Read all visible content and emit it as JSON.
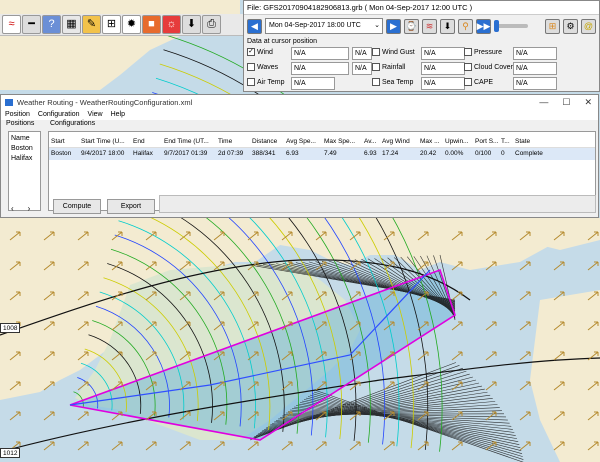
{
  "grib": {
    "file_title": "File: GFS20170904182906813.grb ( Mon 04-Sep-2017 12:00  UTC )",
    "date_value": "Mon 04-Sep-2017 18:00  UTC",
    "cursor_header": "Data at cursor position",
    "fields": [
      {
        "label": "Wind",
        "checked": true,
        "v1": "N/A",
        "v2": "N/A"
      },
      {
        "label": "Wind Gust",
        "checked": false,
        "v1": "N/A"
      },
      {
        "label": "Pressure",
        "checked": false,
        "v1": "N/A"
      },
      {
        "label": "Waves",
        "checked": false,
        "v1": "N/A",
        "v2": "N/A"
      },
      {
        "label": "Rainfall",
        "checked": false,
        "v1": "N/A"
      },
      {
        "label": "Cloud Cover",
        "checked": false,
        "v1": "N/A"
      },
      {
        "label": "Air Temp",
        "checked": false,
        "v1": "N/A"
      },
      {
        "label": "Sea Temp",
        "checked": false,
        "v1": "N/A"
      },
      {
        "label": "CAPE",
        "checked": false,
        "v1": "N/A"
      }
    ]
  },
  "wr": {
    "title": "Weather Routing - WeatherRoutingConfiguration.xml",
    "menu": [
      "Position",
      "Configuration",
      "View",
      "Help"
    ],
    "positions_label": "Positions",
    "configurations_label": "Configurations",
    "positions_header": "Name",
    "positions": [
      "Boston",
      "Halifax"
    ],
    "columns": [
      "Start",
      "Start Time (U...",
      "End",
      "End Time (UT...",
      "Time",
      "Distance",
      "Avg Spe...",
      "Max Spe...",
      "Av...",
      "Avg Wind",
      "Max ...",
      "Upwin...",
      "Port S...",
      "T...",
      "State"
    ],
    "row": [
      "Boston",
      "9/4/2017 18:00",
      "Halifax",
      "9/7/2017 01:39",
      "2d 07:39",
      "388/341",
      "6.93",
      "7.49",
      "6.93",
      "17.24",
      "20.42",
      "0.00%",
      "0/100",
      "0",
      "Complete"
    ],
    "compute": "Compute",
    "export": "Export"
  },
  "isobars": [
    "1008",
    "1012"
  ],
  "colors": {
    "land": "#f3ebd1",
    "sea": "#c5dbe8",
    "route": "#e000e0",
    "grib_arrow": "#b58b2f"
  }
}
